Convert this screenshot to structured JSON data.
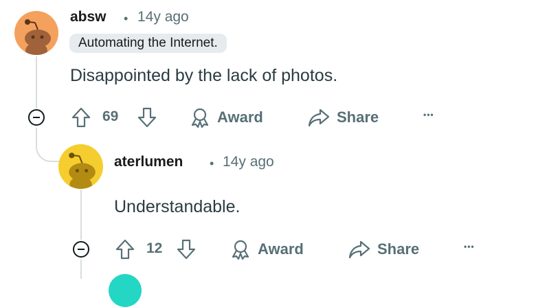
{
  "comments": [
    {
      "username": "absw",
      "separator": "•",
      "age": "14y ago",
      "flair": "Automating the Internet.",
      "body": "Disappointed by the lack of photos.",
      "votes": "69",
      "award_label": "Award",
      "share_label": "Share",
      "more_label": "•••",
      "avatar_color": "#f4a15d"
    },
    {
      "username": "aterlumen",
      "separator": "•",
      "age": "14y ago",
      "body": "Understandable.",
      "votes": "12",
      "award_label": "Award",
      "share_label": "Share",
      "more_label": "•••",
      "avatar_color": "#f5cd2f"
    }
  ],
  "icons": {
    "upvote": "upvote-arrow-icon",
    "downvote": "downvote-arrow-icon",
    "award": "award-ribbon-icon",
    "share": "share-arrow-icon",
    "collapse": "collapse-minus-icon"
  },
  "colors": {
    "meta_gray": "#576f76",
    "thread_line": "#d9dde0",
    "flair_bg": "#e5ebee",
    "next_avatar_teal": "#24d6c4"
  }
}
